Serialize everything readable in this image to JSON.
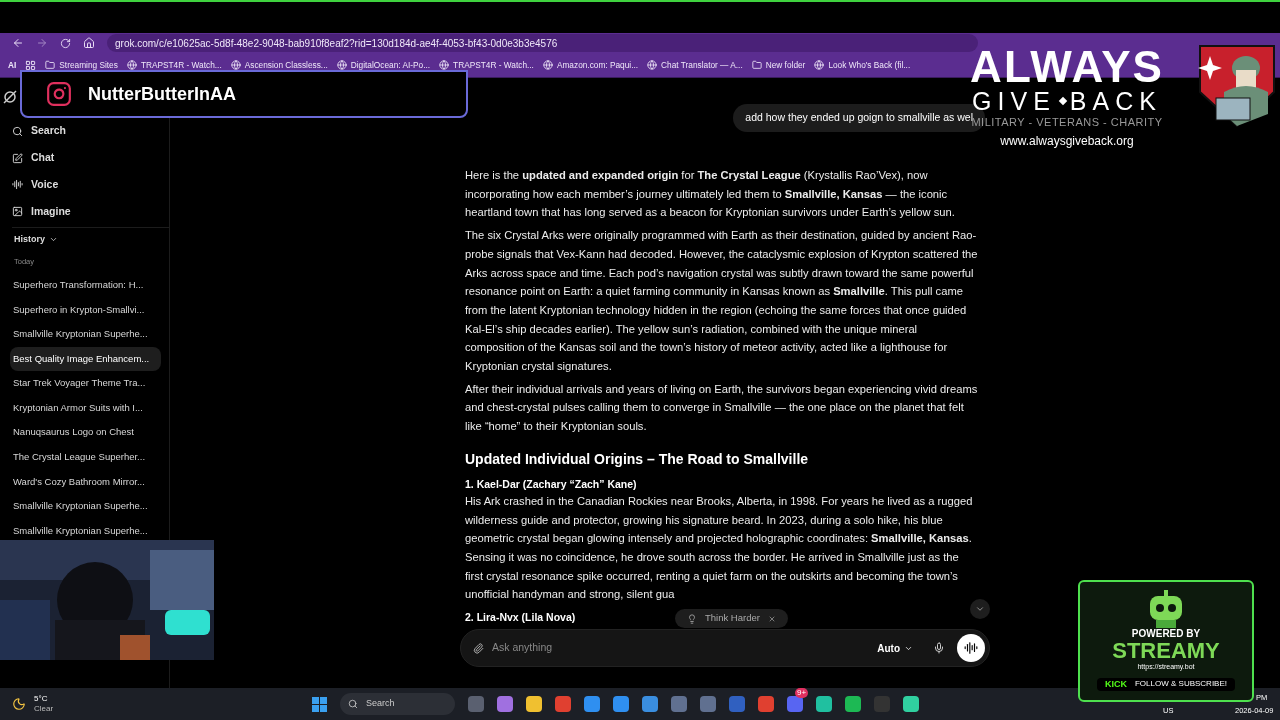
{
  "browser": {
    "url": "grok.com/c/e10625ac-5d8f-48e2-9048-bab910f8eaf2?rid=130d184d-ae4f-4053-bf43-0d0e3b3e4576",
    "apps_label": "AI",
    "bookmarks": [
      {
        "label": "Streaming Sites",
        "kind": "folder"
      },
      {
        "label": "TRAPST4R - Watch...",
        "kind": "site"
      },
      {
        "label": "Ascension Classless...",
        "kind": "site"
      },
      {
        "label": "DigitalOcean: AI-Po...",
        "kind": "site"
      },
      {
        "label": "TRAPST4R - Watch...",
        "kind": "site"
      },
      {
        "label": "Amazon.com: Paqui...",
        "kind": "site"
      },
      {
        "label": "Chat Translator — A...",
        "kind": "site"
      },
      {
        "label": "New folder",
        "kind": "folder"
      },
      {
        "label": "Look Who's Back (fil...",
        "kind": "site"
      }
    ]
  },
  "sidebar": {
    "nav": [
      {
        "label": "Search",
        "kind": "search"
      },
      {
        "label": "Chat",
        "kind": "chat"
      },
      {
        "label": "Voice",
        "kind": "voice"
      },
      {
        "label": "Imagine",
        "kind": "imagine"
      }
    ],
    "history_label": "History",
    "group_label": "Today",
    "history": [
      {
        "label": "Superhero Transformation: H...",
        "selected": false
      },
      {
        "label": "Superhero in Krypton-Smallvi...",
        "selected": false
      },
      {
        "label": "Smallville Kryptonian Superhe...",
        "selected": false
      },
      {
        "label": "Best Quality Image Enhancem...",
        "selected": true
      },
      {
        "label": "Star Trek Voyager Theme Tra...",
        "selected": false
      },
      {
        "label": "Kryptonian Armor Suits with I...",
        "selected": false
      },
      {
        "label": "Nanuqsaurus Logo on Chest",
        "selected": false
      },
      {
        "label": "The Crystal League Superher...",
        "selected": false
      },
      {
        "label": "Ward's Cozy Bathroom Mirror...",
        "selected": false
      },
      {
        "label": "Smallville Kryptonian Superhe...",
        "selected": false
      },
      {
        "label": "Smallville Kryptonian Superhe...",
        "selected": false
      }
    ]
  },
  "chat": {
    "user_message": "add how they ended up goign to smallville as wel",
    "response": [
      {
        "kind": "paragraph",
        "text": "Here is the **updated and expanded origin** for **The Crystal League** (Krystallis Rao’Vex), now incorporating how each member’s journey ultimately led them to **Smallville, Kansas** — the iconic heartland town that has long served as a beacon for Kryptonian survivors under Earth’s yellow sun."
      },
      {
        "kind": "paragraph",
        "text": "The six Crystal Arks were originally programmed with Earth as their destination, guided by ancient Rao-probe signals that Vex-Kann had decoded. However, the cataclysmic explosion of Krypton scattered the Arks across space and time. Each pod’s navigation crystal was subtly drawn toward the same powerful resonance point on Earth: a quiet farming community in Kansas known as **Smallville**. This pull came from the latent Kryptonian technology hidden in the region (echoing the same forces that once guided Kal-El’s ship decades earlier). The yellow sun’s radiation, combined with the unique mineral composition of the Kansas soil and the town’s history of meteor activity, acted like a lighthouse for Kryptonian crystal signatures."
      },
      {
        "kind": "paragraph",
        "text": "After their individual arrivals and years of living on Earth, the survivors began experiencing vivid dreams and chest-crystal pulses calling them to converge in Smallville — the one place on the planet that felt like “home” to their Kryptonian souls."
      },
      {
        "kind": "heading",
        "text": "Updated Individual Origins – The Road to Smallville"
      },
      {
        "kind": "subheading",
        "text": "1. Kael-Dar (Zachary “Zach” Kane)"
      },
      {
        "kind": "paragraph",
        "text": "His Ark crashed in the Canadian Rockies near Brooks, Alberta, in 1998. For years he lived as a rugged wilderness guide and protector, growing his signature beard. In 2023, during a solo hike, his blue geometric crystal began glowing intensely and projected holographic coordinates: **Smallville, Kansas**. Sensing it was no coincidence, he drove south across the border. He arrived in Smallville just as the first crystal resonance spike occurred, renting a quiet farm on the outskirts and becoming the town’s unofficial handyman and strong, silent gua"
      },
      {
        "kind": "subheading",
        "text": "2. Lira-Nvx (Lila Nova)"
      }
    ],
    "chip": "Think Harder",
    "placeholder": "Ask anything",
    "model": "Auto"
  },
  "overlays": {
    "instagram_handle": "NutterButterInAA",
    "charity": {
      "title": "ALWAYS",
      "subtitle_left": "GIVE",
      "subtitle_right": "BACK",
      "tagline": "MILITARY - VETERANS - CHARITY",
      "url": "www.alwaysgiveback.org"
    },
    "streamy": {
      "top": "POWERED BY",
      "name": "STREAMY",
      "url": "https://streamy.bot",
      "platform": "KICK",
      "cta": "FOLLOW & SUBSCRIBE!"
    }
  },
  "taskbar": {
    "temperature": "5°C",
    "condition": "Clear",
    "search": "Search",
    "badge": "9+",
    "language": "US",
    "time": "PM",
    "date": "2026-04-09"
  }
}
